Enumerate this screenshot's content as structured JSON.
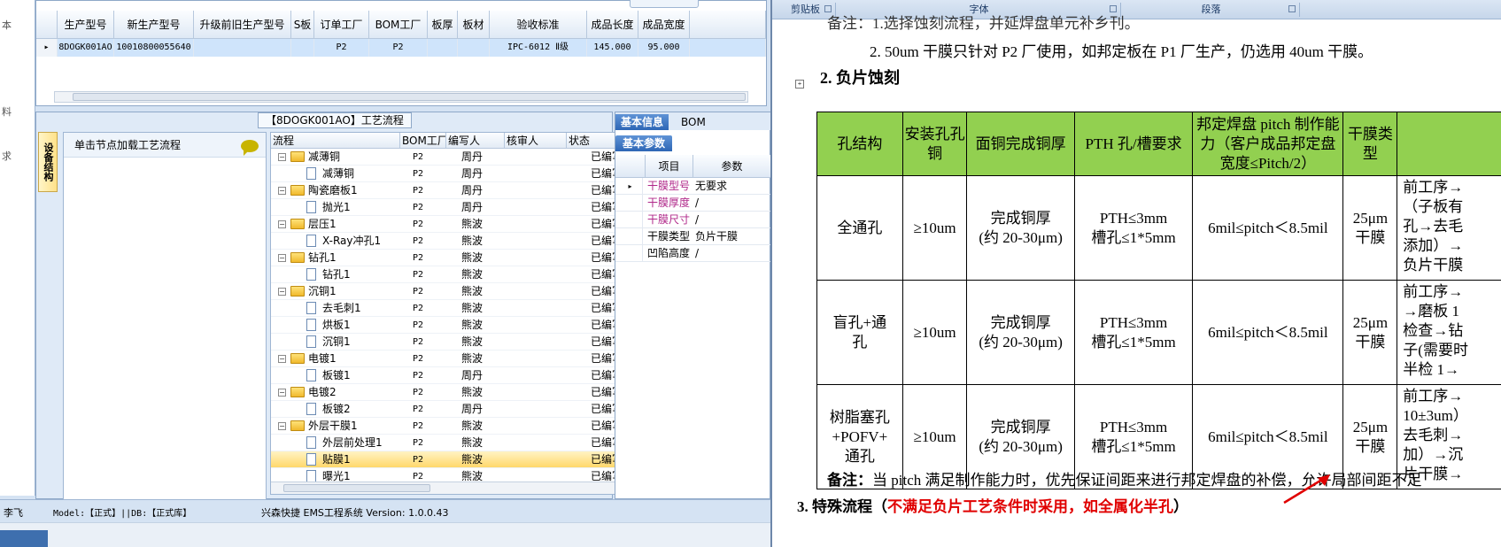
{
  "left_strip": [
    "本",
    "料",
    "求"
  ],
  "top_grid": {
    "tab_stub": "",
    "headers": [
      "生产型号",
      "新生产型号",
      "升级前旧生产型号",
      "S板",
      "订单工厂",
      "BOM工厂",
      "板厚",
      "板材",
      "验收标准",
      "成品长度",
      "成品宽度"
    ],
    "row": [
      "8DOGK001AO",
      "10010800055640",
      "",
      "",
      "P2",
      "P2",
      "",
      "",
      "IPC-6012 Ⅱ级",
      "145.000",
      "95.000"
    ]
  },
  "process_panel": {
    "title": "【8DOGK001AO】工艺流程",
    "vertical_tab": "设备结构",
    "node_pane_text": "单击节点加载工艺流程",
    "columns": [
      "流程",
      "BOM工厂",
      "编写人",
      "核审人",
      "状态"
    ],
    "rows": [
      {
        "level": 1,
        "type": "folder",
        "name": "减薄铜",
        "bom": "P2",
        "writer": "周丹",
        "reviewer": "",
        "status": "已编写"
      },
      {
        "level": 2,
        "type": "doc",
        "name": "减薄铜",
        "bom": "P2",
        "writer": "周丹",
        "reviewer": "",
        "status": "已编写"
      },
      {
        "level": 1,
        "type": "folder",
        "name": "陶瓷磨板1",
        "bom": "P2",
        "writer": "周丹",
        "reviewer": "",
        "status": "已编写"
      },
      {
        "level": 2,
        "type": "doc",
        "name": "抛光1",
        "bom": "P2",
        "writer": "周丹",
        "reviewer": "",
        "status": "已编写"
      },
      {
        "level": 1,
        "type": "folder",
        "name": "层压1",
        "bom": "P2",
        "writer": "熊波",
        "reviewer": "",
        "status": "已编写"
      },
      {
        "level": 2,
        "type": "doc",
        "name": "X-Ray冲孔1",
        "bom": "P2",
        "writer": "熊波",
        "reviewer": "",
        "status": "已编写"
      },
      {
        "level": 1,
        "type": "folder",
        "name": "钻孔1",
        "bom": "P2",
        "writer": "熊波",
        "reviewer": "",
        "status": "已编写"
      },
      {
        "level": 2,
        "type": "doc",
        "name": "钻孔1",
        "bom": "P2",
        "writer": "熊波",
        "reviewer": "",
        "status": "已编写"
      },
      {
        "level": 1,
        "type": "folder",
        "name": "沉铜1",
        "bom": "P2",
        "writer": "熊波",
        "reviewer": "",
        "status": "已编写"
      },
      {
        "level": 2,
        "type": "doc",
        "name": "去毛刺1",
        "bom": "P2",
        "writer": "熊波",
        "reviewer": "",
        "status": "已编写"
      },
      {
        "level": 2,
        "type": "doc",
        "name": "烘板1",
        "bom": "P2",
        "writer": "熊波",
        "reviewer": "",
        "status": "已编写"
      },
      {
        "level": 2,
        "type": "doc",
        "name": "沉铜1",
        "bom": "P2",
        "writer": "熊波",
        "reviewer": "",
        "status": "已编写"
      },
      {
        "level": 1,
        "type": "folder",
        "name": "电镀1",
        "bom": "P2",
        "writer": "熊波",
        "reviewer": "",
        "status": "已编写"
      },
      {
        "level": 2,
        "type": "doc",
        "name": "板镀1",
        "bom": "P2",
        "writer": "周丹",
        "reviewer": "",
        "status": "已编写"
      },
      {
        "level": 1,
        "type": "folder",
        "name": "电镀2",
        "bom": "P2",
        "writer": "熊波",
        "reviewer": "",
        "status": "已编写"
      },
      {
        "level": 2,
        "type": "doc",
        "name": "板镀2",
        "bom": "P2",
        "writer": "周丹",
        "reviewer": "",
        "status": "已编写"
      },
      {
        "level": 1,
        "type": "folder",
        "name": "外层干膜1",
        "bom": "P2",
        "writer": "熊波",
        "reviewer": "",
        "status": "已编写"
      },
      {
        "level": 2,
        "type": "doc",
        "name": "外层前处理1",
        "bom": "P2",
        "writer": "熊波",
        "reviewer": "",
        "status": "已编写"
      },
      {
        "level": 2,
        "type": "doc",
        "name": "贴膜1",
        "bom": "P2",
        "writer": "熊波",
        "reviewer": "",
        "status": "已编写",
        "selected": true
      },
      {
        "level": 2,
        "type": "doc",
        "name": "曝光1",
        "bom": "P2",
        "writer": "熊波",
        "reviewer": "",
        "status": "已编写"
      }
    ]
  },
  "info_panel": {
    "tabs": [
      "基本信息",
      "BOM"
    ],
    "sub_tab": "基本参数",
    "columns": [
      "项目",
      "参数"
    ],
    "rows": [
      {
        "key": "干膜型号",
        "value": "无要求",
        "highlight": true
      },
      {
        "key": "干膜厚度",
        "value": "/",
        "highlight": true
      },
      {
        "key": "干膜尺寸",
        "value": "/",
        "highlight": true
      },
      {
        "key": "干膜类型",
        "value": "负片干膜",
        "highlight": false
      },
      {
        "key": "凹陷高度",
        "value": "/",
        "highlight": false
      }
    ]
  },
  "status_bar": {
    "left": "李飞",
    "model": "Model:【正式】||DB:【正式库】",
    "app": "兴森快捷 EMS工程系统 Version: 1.0.0.43"
  },
  "word": {
    "ribbon_groups": [
      "剪贴板",
      "字体",
      "段落"
    ],
    "doc_top_cut": "备注：1.选择蚀刻流程，并延焊盘单元补乡刊。",
    "note2": "2. 50um 干膜只针对 P2 厂使用，如邦定板在 P1 厂生产，仍选用 40um 干膜。",
    "section2": "2.  负片蚀刻",
    "table_headers": [
      "孔结构",
      "安装孔孔铜",
      "面铜完成铜厚",
      "PTH 孔/槽要求",
      "邦定焊盘 pitch 制作能力（客户成品邦定盘宽度≤Pitch/2）",
      "干膜类型",
      ""
    ],
    "table_rows": [
      {
        "hole": "全通孔",
        "mount": "≥10um",
        "copper": "完成铜厚\n(约 20-30μm)",
        "pth": "PTH≤3mm\n槽孔≤1*5mm",
        "pitch": "6mil≤pitch＜8.5mil",
        "film": "25μm\n干膜",
        "proc": "前工序→\n（子板有\n孔→去毛\n添加）→\n负片干膜"
      },
      {
        "hole": "盲孔+通\n孔",
        "mount": "≥10um",
        "copper": "完成铜厚\n(约 20-30μm)",
        "pth": "PTH≤3mm\n槽孔≤1*5mm",
        "pitch": "6mil≤pitch＜8.5mil",
        "film": "25μm\n干膜",
        "proc": "前工序→\n→磨板 1\n检查→钻\n子(需要时\n半检 1→"
      },
      {
        "hole": "树脂塞孔\n+POFV+\n通孔",
        "mount": "≥10um",
        "copper": "完成铜厚\n(约 20-30μm)",
        "pth": "PTH≤3mm\n槽孔≤1*5mm",
        "pitch": "6mil≤pitch＜8.5mil",
        "film": "25μm\n干膜",
        "proc": "前工序→\n10±3um）\n去毛刺→\n加）→沉\n片干膜→"
      }
    ],
    "note_label": "备注：",
    "note_text": "当 pitch 满足制作能力时，优先保证间距来进行邦定焊盘的补偿，允许局部间距不足",
    "section3_prefix": "3.  特殊流程（",
    "section3_red": "不满足负片工艺条件时采用，如全属化半孔",
    "section3_suffix": "）",
    "colors": {
      "header_green": "#92d050",
      "arrow_red": "#e00000",
      "selection": "#ffd86b"
    }
  }
}
